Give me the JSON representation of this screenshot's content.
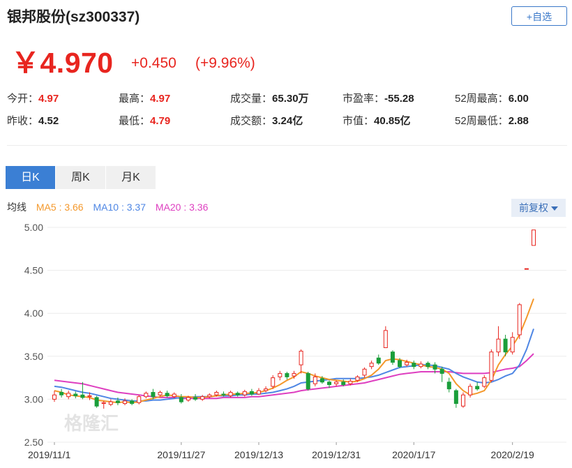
{
  "header": {
    "title": "银邦股份(sz300337)",
    "fav_label": "+自选"
  },
  "quote": {
    "price": "￥4.970",
    "change": "+0.450",
    "change_pct": "(+9.96%)"
  },
  "stats": [
    {
      "label": "今开：",
      "value": "4.97",
      "color": "red"
    },
    {
      "label": "最高：",
      "value": "4.97",
      "color": "red"
    },
    {
      "label": "成交量：",
      "value": "65.30万",
      "color": "dark"
    },
    {
      "label": "市盈率：",
      "value": "-55.28",
      "color": "dark"
    },
    {
      "label": "52周最高：",
      "value": "6.00",
      "color": "dark"
    },
    {
      "label": "昨收：",
      "value": "4.52",
      "color": "dark"
    },
    {
      "label": "最低：",
      "value": "4.79",
      "color": "red"
    },
    {
      "label": "成交额：",
      "value": "3.24亿",
      "color": "dark"
    },
    {
      "label": "市值：",
      "value": "40.85亿",
      "color": "dark"
    },
    {
      "label": "52周最低：",
      "value": "2.88",
      "color": "dark"
    }
  ],
  "tabs": [
    "日K",
    "周K",
    "月K"
  ],
  "ma": {
    "label": "均线",
    "ma5": "MA5 : 3.66",
    "ma10": "MA10 : 3.37",
    "ma20": "MA20 : 3.36"
  },
  "adjust_label": "前复权",
  "watermark": "格隆汇",
  "colors": {
    "up": "#e8251f",
    "down": "#1a9e3a",
    "ma5": "#f4982b",
    "ma10": "#4e86e4",
    "ma20": "#de3fc0",
    "accent": "#3b7fd4"
  },
  "chart_data": {
    "type": "candlestick",
    "ylim": [
      2.5,
      5.0
    ],
    "yticks": [
      "5.00",
      "4.50",
      "4.00",
      "3.50",
      "3.00",
      "2.50"
    ],
    "x_labels": [
      "2019/11/1",
      "2019/11/27",
      "2019/12/13",
      "2019/12/31",
      "2020/1/17",
      "2020/2/19"
    ],
    "x_label_index": [
      0,
      18,
      29,
      40,
      51,
      65
    ],
    "candles": [
      [
        3.0,
        3.05,
        3.1,
        2.97
      ],
      [
        3.08,
        3.05,
        3.12,
        3.02
      ],
      [
        3.03,
        3.07,
        3.1,
        3.0
      ],
      [
        3.06,
        3.04,
        3.09,
        3.01
      ],
      [
        3.05,
        3.02,
        3.2,
        3.0
      ],
      [
        3.03,
        3.04,
        3.08,
        2.99
      ],
      [
        3.02,
        2.92,
        3.04,
        2.9
      ],
      [
        2.95,
        2.96,
        2.98,
        2.89
      ],
      [
        2.94,
        2.97,
        3.0,
        2.92
      ],
      [
        2.98,
        2.96,
        3.02,
        2.93
      ],
      [
        2.95,
        2.98,
        3.01,
        2.93
      ],
      [
        2.98,
        2.95,
        3.0,
        2.93
      ],
      [
        2.96,
        3.03,
        3.05,
        2.94
      ],
      [
        3.03,
        3.07,
        3.09,
        3.01
      ],
      [
        3.08,
        3.03,
        3.12,
        3.0
      ],
      [
        3.05,
        3.08,
        3.1,
        3.03
      ],
      [
        3.07,
        3.04,
        3.1,
        3.02
      ],
      [
        3.03,
        3.06,
        3.08,
        3.01
      ],
      [
        3.02,
        2.97,
        3.06,
        2.95
      ],
      [
        2.99,
        3.02,
        3.04,
        2.97
      ],
      [
        3.02,
        3.0,
        3.06,
        2.98
      ],
      [
        3.0,
        3.03,
        3.05,
        2.98
      ],
      [
        3.03,
        3.05,
        3.07,
        3.01
      ],
      [
        3.05,
        3.08,
        3.1,
        3.03
      ],
      [
        3.06,
        3.05,
        3.09,
        3.03
      ],
      [
        3.04,
        3.08,
        3.1,
        3.02
      ],
      [
        3.07,
        3.05,
        3.09,
        3.03
      ],
      [
        3.05,
        3.09,
        3.11,
        3.03
      ],
      [
        3.09,
        3.06,
        3.12,
        3.04
      ],
      [
        3.06,
        3.1,
        3.13,
        3.05
      ],
      [
        3.1,
        3.12,
        3.15,
        3.08
      ],
      [
        3.15,
        3.25,
        3.28,
        3.12
      ],
      [
        3.26,
        3.3,
        3.33,
        3.22
      ],
      [
        3.3,
        3.26,
        3.32,
        3.23
      ],
      [
        3.27,
        3.3,
        3.33,
        3.24
      ],
      [
        3.4,
        3.56,
        3.58,
        3.3
      ],
      [
        3.3,
        3.12,
        3.32,
        3.1
      ],
      [
        3.18,
        3.26,
        3.3,
        3.15
      ],
      [
        3.24,
        3.2,
        3.27,
        3.18
      ],
      [
        3.2,
        3.17,
        3.22,
        3.13
      ],
      [
        3.18,
        3.2,
        3.22,
        3.15
      ],
      [
        3.2,
        3.17,
        3.23,
        3.15
      ],
      [
        3.18,
        3.21,
        3.24,
        3.16
      ],
      [
        3.22,
        3.26,
        3.28,
        3.2
      ],
      [
        3.28,
        3.35,
        3.37,
        3.25
      ],
      [
        3.38,
        3.42,
        3.45,
        3.35
      ],
      [
        3.48,
        3.42,
        3.52,
        3.4
      ],
      [
        3.6,
        3.8,
        3.85,
        3.62
      ],
      [
        3.55,
        3.43,
        3.57,
        3.4
      ],
      [
        3.45,
        3.38,
        3.48,
        3.36
      ],
      [
        3.4,
        3.43,
        3.46,
        3.38
      ],
      [
        3.42,
        3.38,
        3.45,
        3.35
      ],
      [
        3.38,
        3.41,
        3.44,
        3.36
      ],
      [
        3.42,
        3.38,
        3.44,
        3.35
      ],
      [
        3.4,
        3.35,
        3.43,
        3.3
      ],
      [
        3.35,
        3.3,
        3.38,
        3.2
      ],
      [
        3.2,
        3.12,
        3.25,
        3.08
      ],
      [
        3.1,
        2.95,
        3.12,
        2.9
      ],
      [
        2.92,
        3.05,
        3.08,
        2.9
      ],
      [
        3.05,
        3.15,
        3.18,
        3.02
      ],
      [
        3.15,
        3.12,
        3.2,
        3.1
      ],
      [
        3.15,
        3.25,
        3.28,
        3.13
      ],
      [
        3.22,
        3.55,
        3.58,
        3.2
      ],
      [
        3.55,
        3.7,
        3.85,
        3.5
      ],
      [
        3.7,
        3.55,
        3.75,
        3.5
      ],
      [
        3.55,
        3.72,
        3.78,
        3.52
      ],
      [
        3.75,
        4.1,
        4.12,
        3.7
      ],
      [
        4.52,
        4.52,
        4.52,
        4.52
      ],
      [
        4.79,
        4.97,
        4.97,
        4.79
      ]
    ],
    "ma5": [
      3.1,
      3.08,
      3.05,
      3.04,
      3.03,
      3.02,
      2.99,
      2.98,
      2.97,
      2.96,
      2.97,
      2.96,
      2.97,
      2.99,
      3.01,
      3.03,
      3.05,
      3.04,
      3.03,
      3.03,
      3.02,
      3.02,
      3.03,
      3.04,
      3.05,
      3.06,
      3.06,
      3.07,
      3.07,
      3.08,
      3.1,
      3.13,
      3.17,
      3.22,
      3.26,
      3.32,
      3.3,
      3.27,
      3.25,
      3.23,
      3.22,
      3.21,
      3.2,
      3.21,
      3.24,
      3.28,
      3.35,
      3.45,
      3.47,
      3.46,
      3.44,
      3.42,
      3.4,
      3.38,
      3.37,
      3.35,
      3.3,
      3.18,
      3.1,
      3.05,
      3.07,
      3.1,
      3.22,
      3.4,
      3.52,
      3.62,
      3.75,
      3.95,
      4.17
    ],
    "ma10": [
      3.15,
      3.14,
      3.12,
      3.1,
      3.08,
      3.07,
      3.05,
      3.03,
      3.01,
      3.0,
      2.99,
      2.98,
      2.98,
      2.98,
      2.99,
      2.99,
      3.0,
      3.01,
      3.02,
      3.02,
      3.03,
      3.03,
      3.03,
      3.04,
      3.04,
      3.04,
      3.05,
      3.05,
      3.06,
      3.06,
      3.07,
      3.08,
      3.1,
      3.12,
      3.15,
      3.19,
      3.2,
      3.21,
      3.22,
      3.23,
      3.24,
      3.24,
      3.24,
      3.24,
      3.25,
      3.26,
      3.28,
      3.31,
      3.34,
      3.37,
      3.38,
      3.39,
      3.4,
      3.4,
      3.39,
      3.37,
      3.35,
      3.3,
      3.26,
      3.23,
      3.2,
      3.19,
      3.2,
      3.23,
      3.27,
      3.3,
      3.4,
      3.58,
      3.82
    ],
    "ma20": [
      3.22,
      3.21,
      3.2,
      3.19,
      3.18,
      3.16,
      3.14,
      3.12,
      3.1,
      3.08,
      3.07,
      3.06,
      3.05,
      3.04,
      3.03,
      3.02,
      3.02,
      3.02,
      3.01,
      3.01,
      3.01,
      3.01,
      3.01,
      3.01,
      3.02,
      3.02,
      3.02,
      3.02,
      3.03,
      3.03,
      3.04,
      3.05,
      3.06,
      3.07,
      3.08,
      3.1,
      3.11,
      3.12,
      3.13,
      3.14,
      3.15,
      3.16,
      3.17,
      3.18,
      3.19,
      3.21,
      3.23,
      3.25,
      3.27,
      3.29,
      3.3,
      3.31,
      3.32,
      3.32,
      3.32,
      3.32,
      3.32,
      3.31,
      3.3,
      3.3,
      3.3,
      3.3,
      3.31,
      3.33,
      3.35,
      3.36,
      3.38,
      3.45,
      3.53
    ]
  }
}
